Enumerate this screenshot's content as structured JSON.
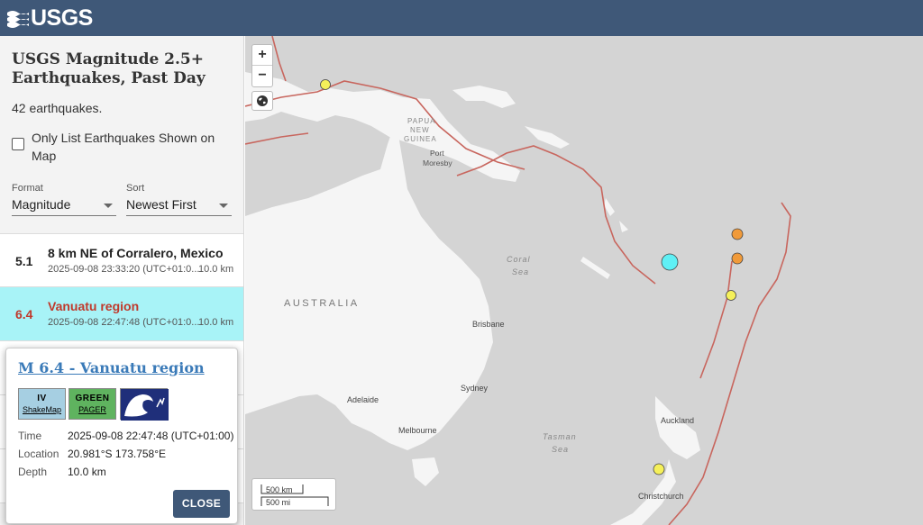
{
  "header": {
    "logo_text": "USGS"
  },
  "sidebar": {
    "title": "USGS Magnitude 2.5+ Earthquakes, Past Day",
    "count": "42 earthquakes.",
    "only_list_label": "Only List Earthquakes Shown on Map",
    "only_list_checked": false,
    "format_label": "Format",
    "format_value": "Magnitude",
    "sort_label": "Sort",
    "sort_value": "Newest First"
  },
  "earthquakes": [
    {
      "mag": "5.1",
      "place": "8 km NE of Corralero, Mexico",
      "time": "2025-09-08 23:33:20 (UTC+01:0...",
      "depth": "10.0 km",
      "selected": false
    },
    {
      "mag": "6.4",
      "place": "Vanuatu region",
      "time": "2025-09-08 22:47:48 (UTC+01:0...",
      "depth": "10.0 km",
      "selected": true
    }
  ],
  "popup": {
    "title": "M 6.4 - Vanuatu region",
    "shakemap_level": "IV",
    "shakemap_label": "ShakeMap",
    "pager_level": "GREEN",
    "pager_label": "PAGER",
    "time_label": "Time",
    "time_value": "2025-09-08 22:47:48 (UTC+01:00)",
    "location_label": "Location",
    "location_value": "20.981°S 173.758°E",
    "depth_label": "Depth",
    "depth_value": "10.0 km",
    "close_label": "CLOSE"
  },
  "map": {
    "zoom_in": "+",
    "zoom_out": "−",
    "labels": {
      "papua": "PAPUA",
      "new": "NEW",
      "guinea": "GUINEA",
      "port": "Port",
      "moresby": "Moresby",
      "coral": "Coral",
      "sea": "Sea",
      "australia": "AUSTRALIA",
      "brisbane": "Brisbane",
      "sydney": "Sydney",
      "adelaide": "Adelaide",
      "melbourne": "Melbourne",
      "tasman": "Tasman",
      "tasman_sea": "Sea",
      "auckland": "Auckland",
      "christchurch": "Christchurch"
    },
    "scale_km": "500 km",
    "scale_mi": "500 mi"
  },
  "colors": {
    "header": "#3f5878",
    "selected_row": "#a8f3f7",
    "selected_text": "#c0392b",
    "plate_boundary": "#c8665e",
    "quake_yellow": "#f5f05a",
    "quake_orange": "#f09a3a",
    "quake_cyan": "#5ff0f5"
  }
}
